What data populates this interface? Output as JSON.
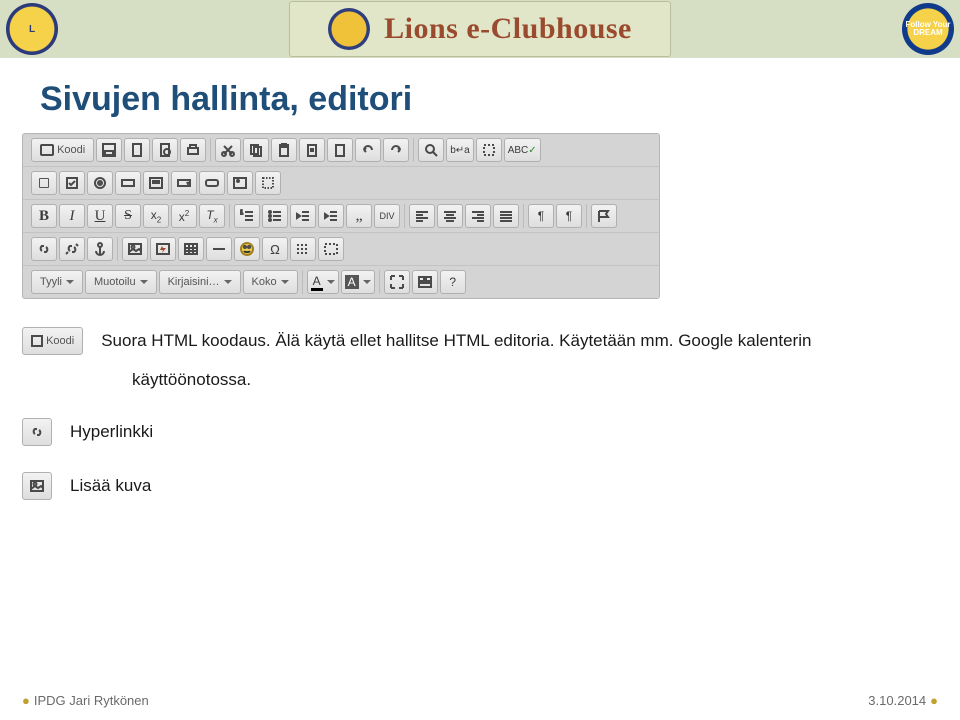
{
  "header": {
    "brand": "Lions e-Clubhouse",
    "left_badge": "L",
    "right_badge": "Follow\nYour\nDREAM"
  },
  "title": "Sivujen hallinta, editori",
  "toolbar": {
    "row1_koodi": "Koodi",
    "row5": {
      "tyyli": "Tyyli",
      "muotoilu": "Muotoilu",
      "kirjaisin": "Kirjaisini…",
      "koko": "Koko",
      "a_minus": "A-",
      "a_solid": "A-",
      "help": "?"
    }
  },
  "captions": {
    "para1_a": "Suora HTML koodaus. Älä käytä ellet hallitse HTML editoria. Käytetään mm. Google kalenterin",
    "para1_b": "käyttöönotossa.",
    "hyper": "Hyperlinkki",
    "image": "Lisää kuva"
  },
  "small_buttons": {
    "koodi": "Koodi"
  },
  "footer": {
    "author": "IPDG Jari Rytkönen",
    "date": "3.10.2014"
  }
}
